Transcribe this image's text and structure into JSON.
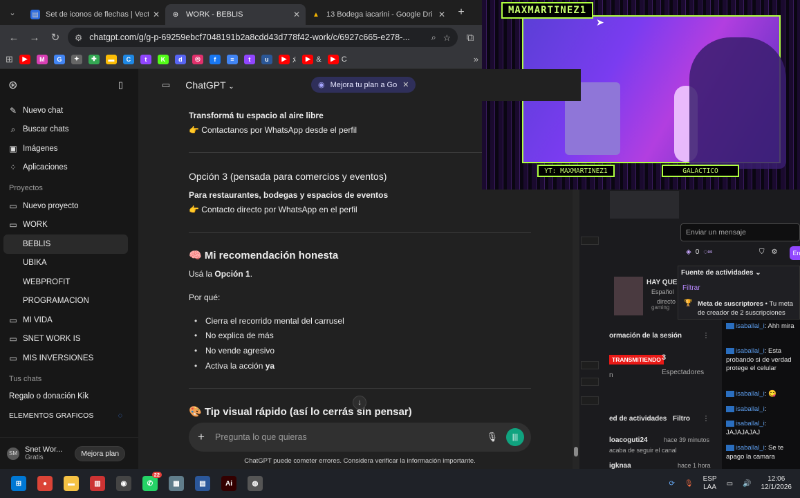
{
  "browser": {
    "tabs": [
      {
        "title": "Set de iconos de flechas | Vecto",
        "favicon_color": "#2d6cdf",
        "active": false
      },
      {
        "title": "WORK - BEBLIS",
        "favicon_color": "#ffffff",
        "active": true
      },
      {
        "title": "13 Bodega iacarini - Google Dri",
        "favicon_color": "#f4b400",
        "active": false
      }
    ],
    "url": "chatgpt.com/g/g-p-69259ebcf7048191b2a8cdd43d778f42-work/c/6927c665-e278-...",
    "bookmarks": [
      {
        "color": "#ff0000",
        "glyph": "▶",
        "label": ""
      },
      {
        "color": "#d93fb4",
        "glyph": "M",
        "label": ""
      },
      {
        "color": "#4285f4",
        "glyph": "G",
        "label": ""
      },
      {
        "color": "#666666",
        "glyph": "✦",
        "label": ""
      },
      {
        "color": "#34a853",
        "glyph": "✚",
        "label": ""
      },
      {
        "color": "#fbbc05",
        "glyph": "▬",
        "label": ""
      },
      {
        "color": "#1e88e5",
        "glyph": "C",
        "label": ""
      },
      {
        "color": "#9146ff",
        "glyph": "t",
        "label": ""
      },
      {
        "color": "#53fc18",
        "glyph": "K",
        "label": ""
      },
      {
        "color": "#5865f2",
        "glyph": "d",
        "label": ""
      },
      {
        "color": "#e1306c",
        "glyph": "◎",
        "label": ""
      },
      {
        "color": "#1877f2",
        "glyph": "f",
        "label": ""
      },
      {
        "color": "#4285f4",
        "glyph": "≡",
        "label": ""
      },
      {
        "color": "#9146ff",
        "glyph": "t",
        "label": ""
      },
      {
        "color": "#2b5797",
        "glyph": "u",
        "label": ""
      },
      {
        "color": "#ff0000",
        "glyph": "▶",
        "label": "ﾒ"
      },
      {
        "color": "#ff0000",
        "glyph": "▶",
        "label": "&"
      },
      {
        "color": "#ff0000",
        "glyph": "▶",
        "label": "C"
      }
    ]
  },
  "sidebar": {
    "nav": [
      {
        "icon": "✎",
        "label": "Nuevo chat"
      },
      {
        "icon": "⌕",
        "label": "Buscar chats"
      },
      {
        "icon": "▣",
        "label": "Imágenes"
      },
      {
        "icon": "⁘",
        "label": "Aplicaciones"
      }
    ],
    "projects_title": "Proyectos",
    "projects": [
      {
        "icon": "▭",
        "label": "Nuevo proyecto",
        "sub": false
      },
      {
        "icon": "▭",
        "label": "WORK",
        "sub": false
      },
      {
        "icon": "",
        "label": "BEBLIS",
        "sub": true,
        "active": true
      },
      {
        "icon": "",
        "label": "UBIKA",
        "sub": true
      },
      {
        "icon": "",
        "label": "WEBPROFIT",
        "sub": true
      },
      {
        "icon": "",
        "label": "PROGRAMACION",
        "sub": true
      },
      {
        "icon": "▭",
        "label": "MI VIDA",
        "sub": false
      },
      {
        "icon": "▭",
        "label": "SNET WORK IS",
        "sub": false
      },
      {
        "icon": "▭",
        "label": "MIS INVERSIONES",
        "sub": false
      }
    ],
    "chats_title": "Tus chats",
    "chats": [
      "Regalo o donación Kik",
      "ELEMENTOS GRAFICOS"
    ],
    "user": {
      "initials": "SM",
      "name": "Snet Wor...",
      "plan": "Gratis",
      "upgrade": "Mejora plan"
    }
  },
  "main": {
    "model": "ChatGPT",
    "upsell": "Mejora tu plan a Go",
    "lines": [
      {
        "text": "Transformá tu espacio al aire libre",
        "y": 0,
        "bold": true
      },
      {
        "text": "👉 Contactanos por WhatsApp desde el perfil",
        "y": 0
      },
      {
        "text": "Opción 3 (pensada para comercios y eventos)",
        "y": 0
      },
      {
        "text": "Para restaurantes, bodegas y espacios de eventos",
        "y": 0,
        "bold": true
      },
      {
        "text": "👉 Contacto directo por WhatsApp en el perfil",
        "y": 0
      },
      {
        "text": "🧠 Mi recomendación honesta",
        "y": 0
      },
      {
        "text_prefix": "Usá la ",
        "text_bold": "Opción 1",
        "text_suffix": "."
      },
      {
        "text": "Por qué:"
      },
      {
        "bullets": [
          "Cierra el recorrido mental del carrusel",
          "No explica de más",
          "No vende agresivo"
        ]
      },
      {
        "bullet_prefix": "Activa la acción ",
        "bullet_bold": "ya"
      },
      {
        "text": "🎨 Tip visual rápido (así lo cerrás sin pensar)"
      }
    ],
    "composer_placeholder": "Pregunta lo que quieras",
    "disclaimer": "ChatGPT puede cometer errores. Considera verificar la información importante."
  },
  "overlay": {
    "streamer_name": "MAXMARTINEZ1",
    "tag_left": "YT: MAXMARTINEZ1",
    "tag_right": "GALACTICO"
  },
  "stream_app": {
    "chat_placeholder": "Enviar un mensaje",
    "points": "0",
    "activity_feed": "Fuente de actividades",
    "filter": "Filtrar",
    "sub_goal_bold": "Meta de suscriptores",
    "sub_goal_text": " • Tu meta de creador de 2 suscripciones",
    "hay_que": "HAY QUE",
    "espanol": "Español",
    "directo": "directo",
    "gaming": "gaming",
    "session_info": "ormación de la sesión",
    "live": "TRANSMITIENDO",
    "viewers_count": "3",
    "viewers_label": "Espectadores",
    "activities": "ed de actividades",
    "filter2": "Filtro",
    "feed_user": "loacoguti24",
    "feed_time": "hace 39 minutos",
    "feed_action": "acaba de seguir el canal",
    "feed_user2": "igknaa",
    "feed_time2": "hace 1 hora",
    "messages": [
      {
        "user": "isaballal_i",
        "text": ": Ahh mira"
      },
      {
        "user": "isaballal_i",
        "text": ": Esta probando si de verdad protege el celular"
      },
      {
        "user": "isaballal_i",
        "text": ": 😋"
      },
      {
        "user": "isaballal_i",
        "text": ":"
      },
      {
        "user": "isaballal_i",
        "text": ": JAJAJAJAJ"
      },
      {
        "user": "isaballal_i",
        "text": ": Se te apago la camara"
      }
    ]
  },
  "taskbar": {
    "apps": [
      {
        "color": "#0078d4",
        "glyph": "⊞"
      },
      {
        "color": "#db4437",
        "glyph": "●"
      },
      {
        "color": "#f5c244",
        "glyph": "▬"
      },
      {
        "color": "#c33",
        "glyph": "▥"
      },
      {
        "color": "#444",
        "glyph": "◉"
      },
      {
        "color": "#25d366",
        "glyph": "✆",
        "badge": "22"
      },
      {
        "color": "#607d8b",
        "glyph": "▦"
      },
      {
        "color": "#2b579a",
        "glyph": "▤"
      },
      {
        "color": "#330000",
        "glyph": "Ai"
      },
      {
        "color": "#555",
        "glyph": "◍"
      }
    ],
    "lang_top": "ESP",
    "lang_bottom": "LAA",
    "time": "12:06",
    "date": "12/1/2026"
  }
}
